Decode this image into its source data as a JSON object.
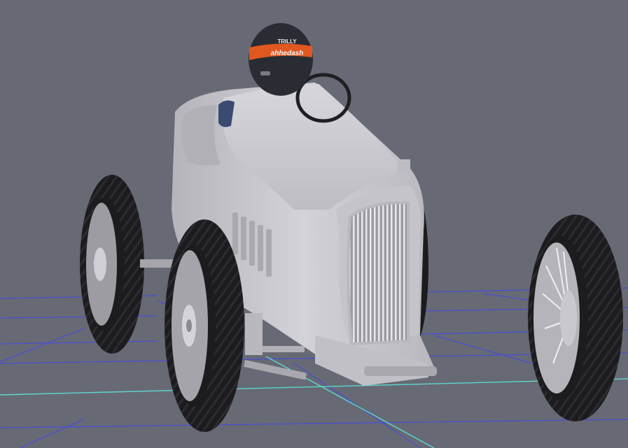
{
  "viewport": {
    "background": "#676a74",
    "grid_color": "#4a4fd0",
    "axis_color": "#5fd6d0"
  },
  "car": {
    "body_color": "#c8c8ce",
    "tire_color": "#1c1c1e",
    "wheel_color": "#a8a8ae",
    "helmet": {
      "color": "#2a2c33",
      "stripe_color": "#e0571f",
      "brand_top": "TRILLY",
      "brand_main": "ahhedash"
    }
  }
}
